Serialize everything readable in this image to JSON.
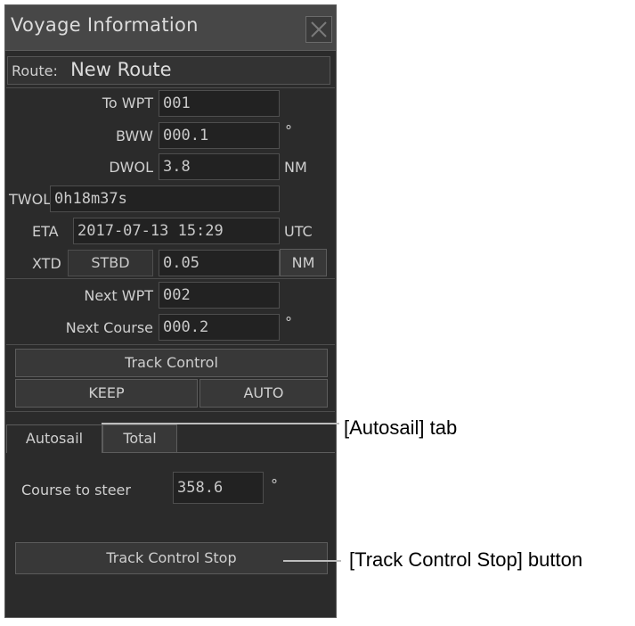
{
  "window": {
    "title": "Voyage Information",
    "close_icon": "close-icon"
  },
  "route": {
    "label": "Route:",
    "value": "New Route"
  },
  "waypoint": {
    "to_wpt_label": "To WPT",
    "to_wpt_value": "001",
    "bww_label": "BWW",
    "bww_value": "000.1",
    "bww_unit": "°",
    "dwol_label": "DWOL",
    "dwol_value": "3.8",
    "dwol_unit": "NM",
    "twol_label": "TWOL",
    "twol_value": "0h18m37s",
    "eta_label": "ETA",
    "eta_value": "2017-07-13 15:29",
    "eta_unit": "UTC",
    "xtd_label": "XTD",
    "xtd_side": "STBD",
    "xtd_value": "0.05",
    "xtd_unit": "NM"
  },
  "next": {
    "next_wpt_label": "Next WPT",
    "next_wpt_value": "002",
    "next_course_label": "Next Course",
    "next_course_value": "000.2",
    "next_course_unit": "°"
  },
  "track_control": {
    "label": "Track Control",
    "keep": "KEEP",
    "auto": "AUTO"
  },
  "tabs": [
    {
      "label": "Autosail"
    },
    {
      "label": "Total"
    }
  ],
  "autosail": {
    "course_label": "Course to steer",
    "course_value": "358.6",
    "course_unit": "°",
    "stop_button": "Track Control Stop"
  },
  "annotations": {
    "autosail_tab": "[Autosail] tab",
    "stop_button": "[Track Control Stop] button"
  }
}
